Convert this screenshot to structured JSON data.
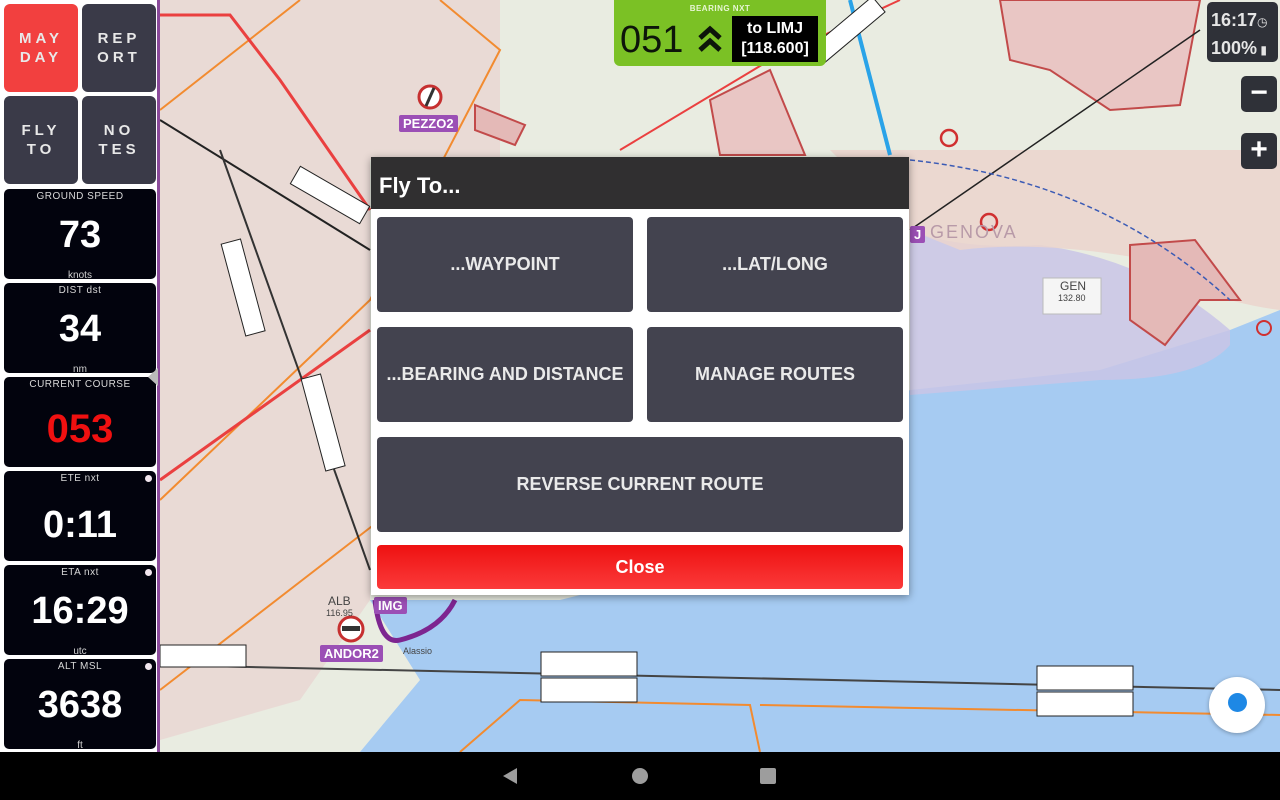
{
  "left_panel": {
    "buttons": [
      {
        "id": "mayday",
        "label": "MAY\nDAY"
      },
      {
        "id": "report",
        "label": "REP\nORT"
      },
      {
        "id": "fly-to",
        "label": "FLY\nTO"
      },
      {
        "id": "notes",
        "label": "NO\nTES"
      }
    ],
    "gauges": [
      {
        "label": "GROUND SPEED",
        "value": "73",
        "unit": "knots",
        "highlight": false
      },
      {
        "label": "DIST dst",
        "value": "34",
        "unit": "nm",
        "highlight": false
      },
      {
        "label": "CURRENT COURSE",
        "value": "053",
        "unit": "",
        "highlight": true
      },
      {
        "label": "ETE nxt",
        "value": "0:11",
        "unit": "",
        "highlight": false
      },
      {
        "label": "ETA nxt",
        "value": "16:29",
        "unit": "utc",
        "highlight": false
      },
      {
        "label": "ALT MSL",
        "value": "3638",
        "unit": "ft",
        "highlight": false
      }
    ]
  },
  "bearing": {
    "label": "BEARING NXT",
    "value": "051",
    "destination": "to LIMJ",
    "frequency": "[118.600]",
    "color": "#7bc125"
  },
  "status": {
    "time": "16:17",
    "battery": "100%"
  },
  "zoom_controls": {
    "minus": "−",
    "plus": "+"
  },
  "map_labels": {
    "pezzo2": "PEZZO2",
    "andor2": "ANDOR2",
    "img": "IMG",
    "j": "J",
    "gen_name": "GEN",
    "gen_freq": "132.80",
    "alb_name": "ALB",
    "alb_freq": "116.95",
    "genova": "GENOVA",
    "alassio": "Alassio"
  },
  "dialog": {
    "title": "Fly To...",
    "buttons": {
      "waypoint": "...WAYPOINT",
      "latlong": "...LAT/LONG",
      "bearing_distance": "...BEARING AND DISTANCE",
      "manage_routes": "MANAGE ROUTES",
      "reverse_route": "REVERSE CURRENT ROUTE"
    },
    "close": "Close"
  }
}
